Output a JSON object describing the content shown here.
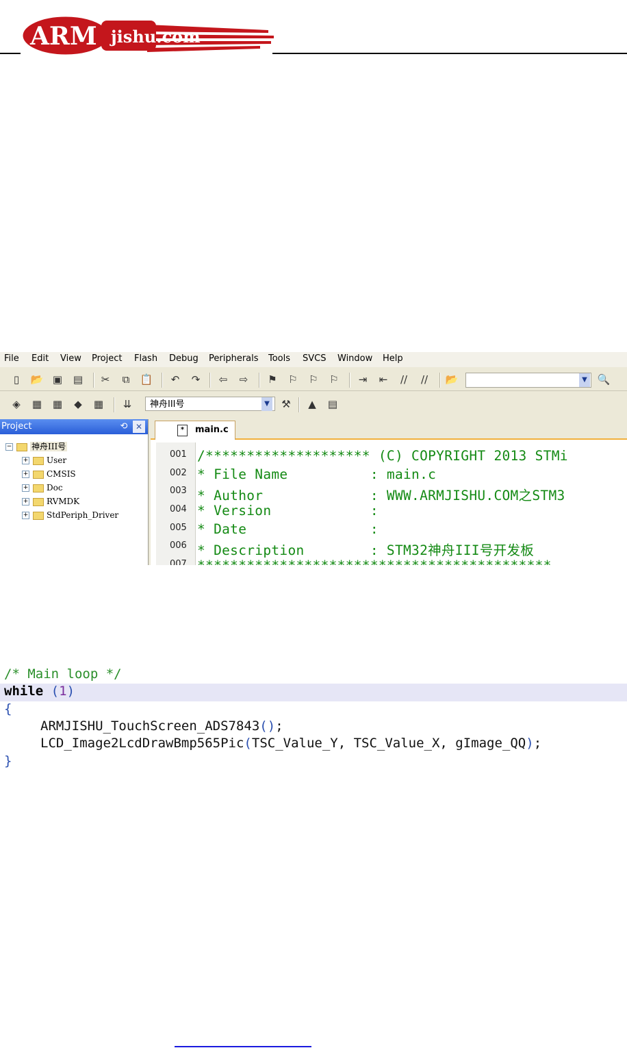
{
  "logo": {
    "arm_text": "ARM",
    "site_text": "jishu.com",
    "colors": {
      "brand_red": "#c4161c",
      "ring_white": "#ffffff"
    }
  },
  "ide": {
    "menu": [
      "File",
      "Edit",
      "View",
      "Project",
      "Flash",
      "Debug",
      "Peripherals",
      "Tools",
      "SVCS",
      "Window",
      "Help"
    ],
    "target_combo_value": "神舟III号",
    "project_pane": {
      "title": "Project",
      "root": "神舟III号",
      "groups": [
        "User",
        "CMSIS",
        "Doc",
        "RVMDK",
        "StdPeriph_Driver"
      ]
    },
    "editor": {
      "tab": "main.c",
      "lines": [
        {
          "num": "001",
          "text": "/******************** (C) COPYRIGHT 2013 STMi"
        },
        {
          "num": "002",
          "text": "* File Name          : main.c"
        },
        {
          "num": "003",
          "text": "* Author             : WWW.ARMJISHU.COM之STM3"
        },
        {
          "num": "004",
          "text": "* Version            :"
        },
        {
          "num": "005",
          "text": "* Date               :"
        },
        {
          "num": "006",
          "text": "* Description        : STM32神舟III号开发板"
        },
        {
          "num": "007",
          "text": "*******************************************"
        }
      ]
    },
    "colors": {
      "code_comment": "#148a14",
      "accent_tab": "#f1b03c"
    }
  },
  "snippet": {
    "comment": "/* Main loop */",
    "while_kw": "while",
    "while_cond_open": "(",
    "while_cond_num": "1",
    "while_cond_close": ")",
    "open_brace": "{",
    "call1": "ARMJISHU_TouchScreen_ADS7843",
    "call1_parens": "()",
    "call1_end": ";",
    "call2_name": "LCD_Image2LcdDrawBmp565Pic",
    "call2_open": "(",
    "call2_args": "TSC_Value_Y, TSC_Value_X, gImage_QQ",
    "call2_close": ")",
    "call2_end": ";",
    "close_brace": "}"
  }
}
